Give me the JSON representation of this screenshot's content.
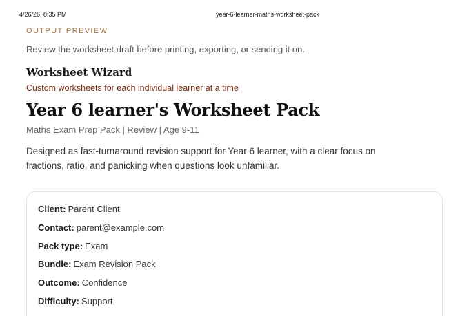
{
  "print_header": {
    "date": "4/26/26, 8:35 PM",
    "title": "year-6-learner-maths-worksheet-pack"
  },
  "preview": {
    "eyebrow": "OUTPUT PREVIEW",
    "lede": "Review the worksheet draft before printing, exporting, or sending it on."
  },
  "brand": {
    "name": "Worksheet Wizard",
    "tagline": "Custom worksheets for each individual learner at a time"
  },
  "document": {
    "title": "Year 6 learner's Worksheet Pack",
    "meta": "Maths Exam Prep Pack | Review | Age 9-11",
    "description": "Designed as fast-turnaround revision support for Year 6 learner, with a clear focus on fractions, ratio, and panicking when questions look unfamiliar."
  },
  "details": [
    {
      "label": "Client",
      "value": "Parent Client"
    },
    {
      "label": "Contact",
      "value": "parent@example.com"
    },
    {
      "label": "Pack type",
      "value": "Exam"
    },
    {
      "label": "Bundle",
      "value": "Exam Revision Pack"
    },
    {
      "label": "Outcome",
      "value": "Confidence"
    },
    {
      "label": "Difficulty",
      "value": "Support"
    }
  ],
  "colors": {
    "eyebrow": "#a6743f",
    "tagline": "#7a2c10",
    "card_border": "#e6e2dc"
  }
}
